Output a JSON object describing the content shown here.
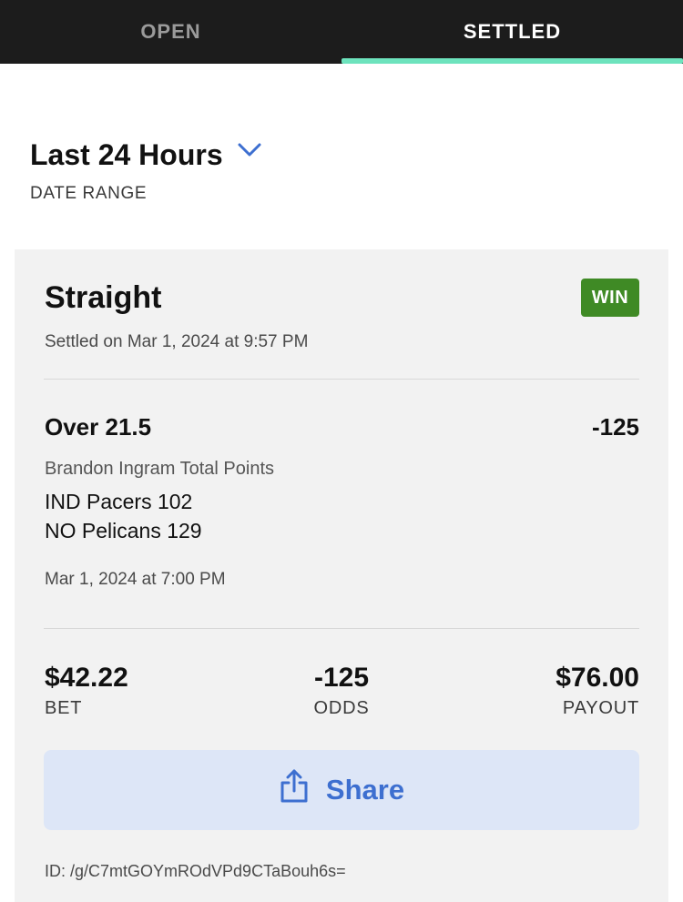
{
  "tabs": {
    "open_label": "OPEN",
    "settled_label": "SETTLED",
    "active": "SETTLED",
    "accent_color": "#6de3bd"
  },
  "filter": {
    "title": "Last 24 Hours",
    "label": "DATE RANGE",
    "icon": "chevron-down-icon"
  },
  "bet": {
    "type": "Straight",
    "result": "WIN",
    "result_color": "#3f8a25",
    "settled_on": "Settled on Mar 1, 2024 at 9:57 PM",
    "selection": "Over 21.5",
    "selection_odds": "-125",
    "market": "Brandon Ingram Total Points",
    "team1": "IND Pacers 102",
    "team2": "NO Pelicans 129",
    "event_time": "Mar 1, 2024 at 7:00 PM",
    "summary": {
      "bet_amount": "$42.22",
      "bet_label": "BET",
      "odds": "-125",
      "odds_label": "ODDS",
      "payout": "$76.00",
      "payout_label": "PAYOUT"
    },
    "share_label": "Share",
    "share_icon": "share-icon",
    "id_text": "ID: /g/C7mtGOYmROdVPd9CTaBouh6s="
  }
}
